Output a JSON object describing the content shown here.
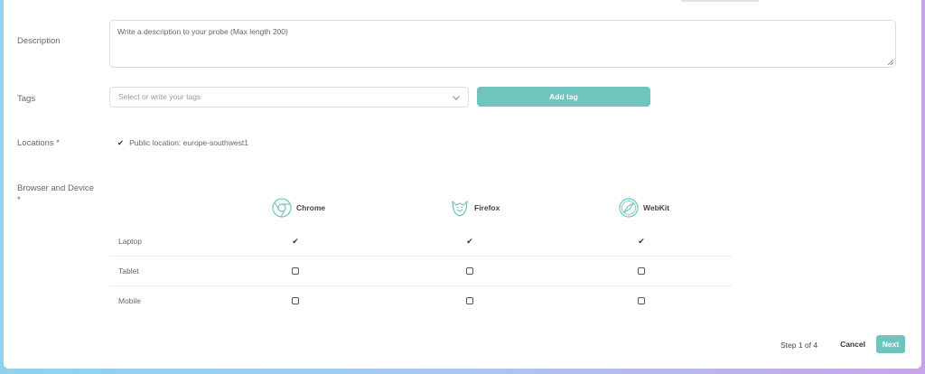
{
  "form": {
    "description": {
      "label": "Description",
      "placeholder": "Write a description to your probe (Max length 200)"
    },
    "tags": {
      "label": "Tags",
      "placeholder": "Select or write your tags",
      "add_button": "Add tag"
    },
    "locations": {
      "label": "Locations *",
      "selected": "Public location: europe-southwest1"
    },
    "browser_device": {
      "label": "Browser and Device",
      "required_mark": "*",
      "browsers": [
        {
          "name": "Chrome",
          "icon": "chrome-icon"
        },
        {
          "name": "Firefox",
          "icon": "firefox-icon"
        },
        {
          "name": "WebKit",
          "icon": "webkit-icon"
        }
      ],
      "devices": [
        {
          "name": "Laptop",
          "checked": [
            true,
            true,
            true
          ]
        },
        {
          "name": "Tablet",
          "checked": [
            false,
            false,
            false
          ]
        },
        {
          "name": "Mobile",
          "checked": [
            false,
            false,
            false
          ]
        }
      ]
    }
  },
  "footer": {
    "step": "Step 1 of 4",
    "cancel": "Cancel",
    "next": "Next"
  },
  "colors": {
    "accent": "#6fc4bd",
    "border": "#dcdcdc"
  }
}
